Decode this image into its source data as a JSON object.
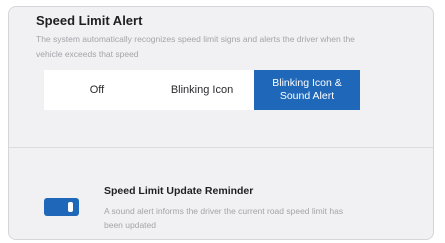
{
  "speed_limit_alert": {
    "title": "Speed Limit Alert",
    "description": "The system automatically recognizes speed limit signs and alerts the driver when the vehicle exceeds that speed",
    "options": [
      {
        "label": "Off",
        "selected": false
      },
      {
        "label": "Blinking Icon",
        "selected": false
      },
      {
        "label": "Blinking Icon &\nSound Alert",
        "selected": true
      }
    ]
  },
  "update_reminder": {
    "title": "Speed Limit Update Reminder",
    "description": "A sound alert informs the driver the current road speed limit has been updated",
    "toggle_on": true
  },
  "colors": {
    "accent": "#1f67b8",
    "panel_bg": "#f1f1f3",
    "text_muted": "#a4a4aa"
  }
}
